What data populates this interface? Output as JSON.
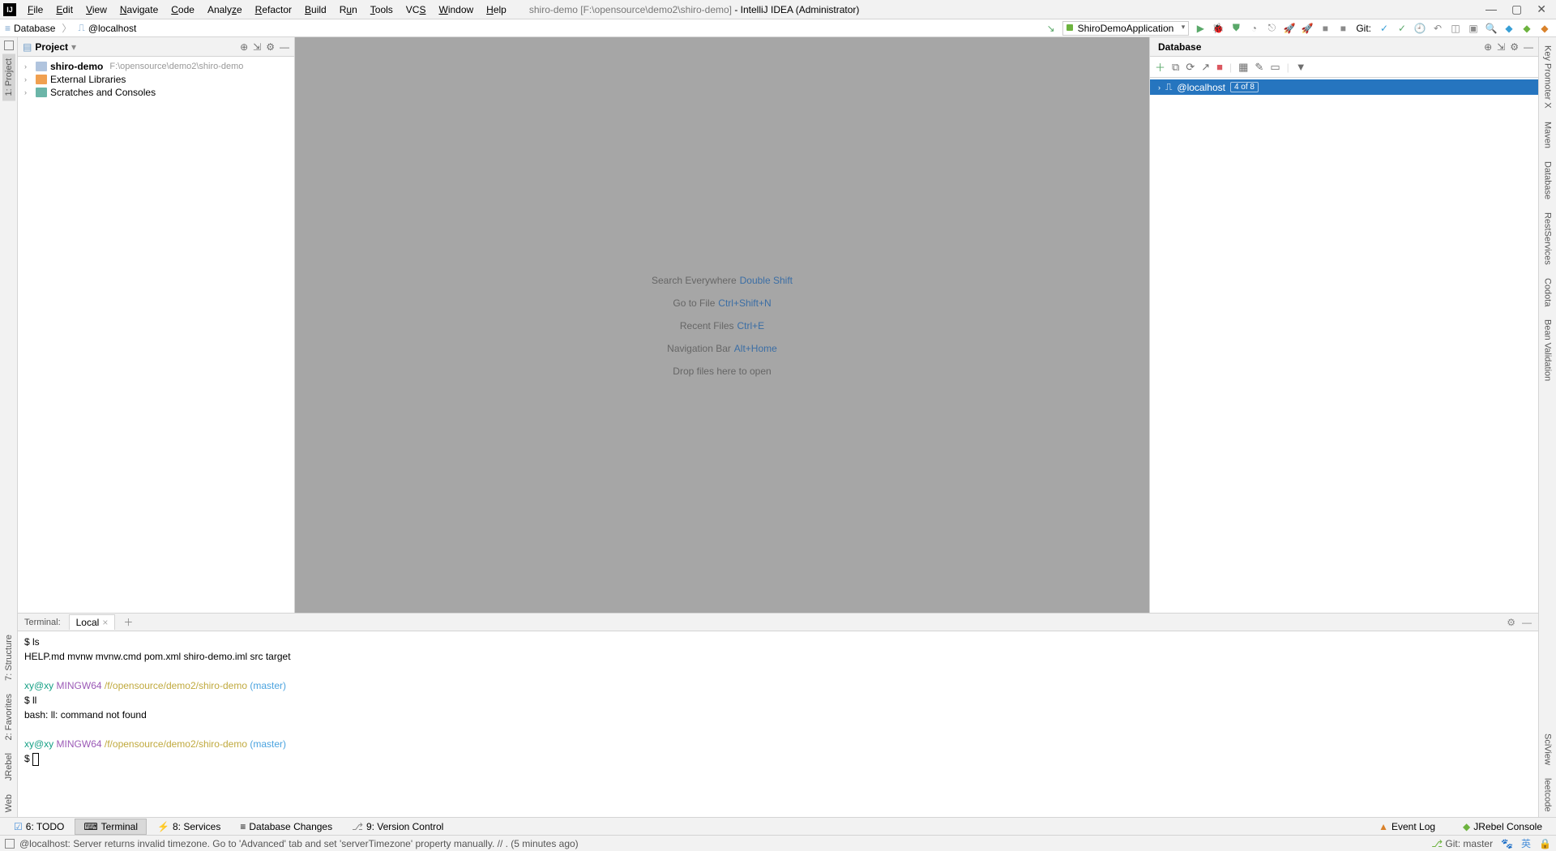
{
  "menu": {
    "items": [
      "File",
      "Edit",
      "View",
      "Navigate",
      "Code",
      "Analyze",
      "Refactor",
      "Build",
      "Run",
      "Tools",
      "VCS",
      "Window",
      "Help"
    ]
  },
  "title": {
    "project": "shiro-demo",
    "path": "[F:\\opensource\\demo2\\shiro-demo]",
    "app": " - IntelliJ IDEA (Administrator)"
  },
  "breadcrumb": {
    "a": "Database",
    "b": "@localhost"
  },
  "runConfig": "ShiroDemoApplication",
  "git_label": "Git:",
  "projectPanel": {
    "title": "Project",
    "root": {
      "name": "shiro-demo",
      "path": "F:\\opensource\\demo2\\shiro-demo"
    },
    "ext": "External Libraries",
    "scratch": "Scratches and Consoles"
  },
  "editorHints": [
    {
      "label": "Search Everywhere",
      "kbd": "Double Shift"
    },
    {
      "label": "Go to File",
      "kbd": "Ctrl+Shift+N"
    },
    {
      "label": "Recent Files",
      "kbd": "Ctrl+E"
    },
    {
      "label": "Navigation Bar",
      "kbd": "Alt+Home"
    },
    {
      "label": "Drop files here to open",
      "kbd": ""
    }
  ],
  "dbPanel": {
    "title": "Database",
    "item": "@localhost",
    "badge": "4 of 8"
  },
  "terminal": {
    "label": "Terminal:",
    "tab": "Local",
    "lines": {
      "cmd1": "$ ls",
      "out1": "HELP.md  mvnw  mvnw.cmd  pom.xml  shiro-demo.iml  src  target",
      "user": "xy@xy",
      "host": "MINGW64",
      "path": "/f/opensource/demo2/shiro-demo",
      "branch": "(master)",
      "cmd2": "$ ll",
      "out2": "bash: ll: command not found",
      "cmd3": "$ "
    }
  },
  "bottomTabs": {
    "todo": "6: TODO",
    "terminal": "Terminal",
    "services": "8: Services",
    "dbchanges": "Database Changes",
    "vcs": "9: Version Control",
    "eventlog": "Event Log",
    "jrebel": "JRebel Console"
  },
  "status": {
    "msg": "@localhost: Server returns invalid timezone. Go to 'Advanced' tab and set 'serverTimezone' property manually. // . (5 minutes ago)",
    "git": "Git: master"
  },
  "leftGutter": [
    "1: Project",
    "2: Favorites",
    "7: Structure",
    "JRebel",
    "Web"
  ],
  "rightGutter": [
    "Key Promoter X",
    "Maven",
    "Database",
    "RestServices",
    "Codota",
    "Bean Validation",
    "leetcode",
    "SciView"
  ]
}
